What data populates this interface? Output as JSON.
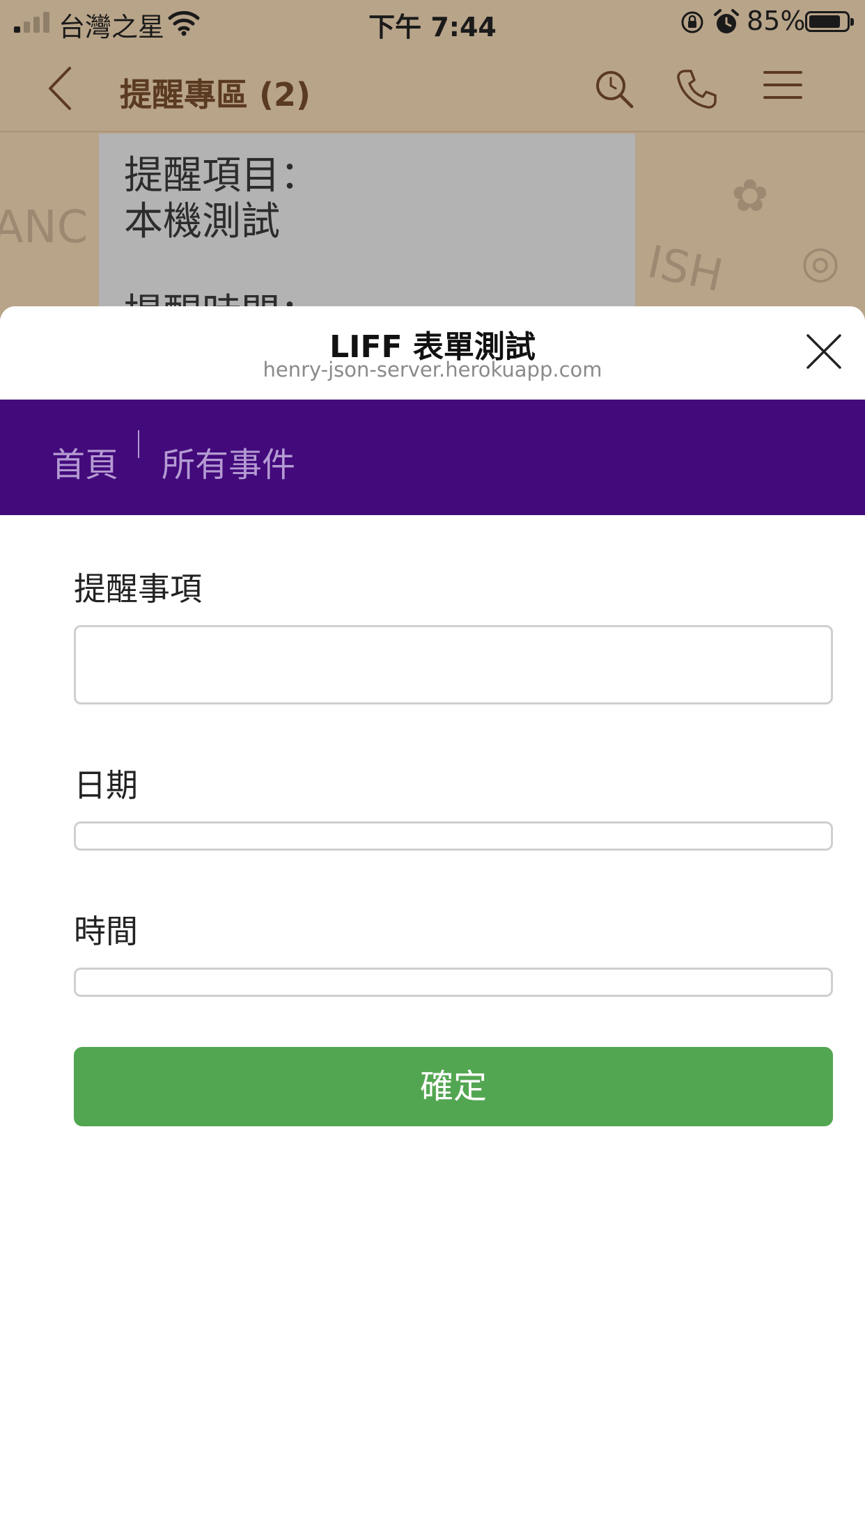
{
  "status_bar": {
    "carrier": "台灣之星",
    "time": "下午 7:44",
    "battery_percent": "85%",
    "battery_level": 0.85,
    "signal_bars_active": 1,
    "signal_bars_total": 4
  },
  "chat": {
    "title": "提醒專區 (2)",
    "bubble_text": "提醒項目：\n本機測試\n\n提醒時間："
  },
  "liff": {
    "title": "LIFF 表單測試",
    "url": "henry-json-server.herokuapp.com",
    "nav": {
      "home": "首頁",
      "all_events": "所有事件"
    },
    "form": {
      "reminder_label": "提醒事項",
      "reminder_value": "",
      "date_label": "日期",
      "date_value": "",
      "time_label": "時間",
      "time_value": "",
      "submit_label": "確定"
    }
  },
  "colors": {
    "nav_background": "#420a7b",
    "nav_text": "#b49ad2",
    "submit_button": "#53a651",
    "chat_header_text": "#5b3a22",
    "dimmed_background": "#b8a489"
  },
  "icons": {
    "back": "chevron-left-icon",
    "search": "search-icon",
    "call": "phone-icon",
    "menu": "menu-icon",
    "close": "close-icon",
    "wifi": "wifi-icon",
    "rotation_lock": "rotation-lock-icon",
    "alarm": "alarm-icon"
  }
}
